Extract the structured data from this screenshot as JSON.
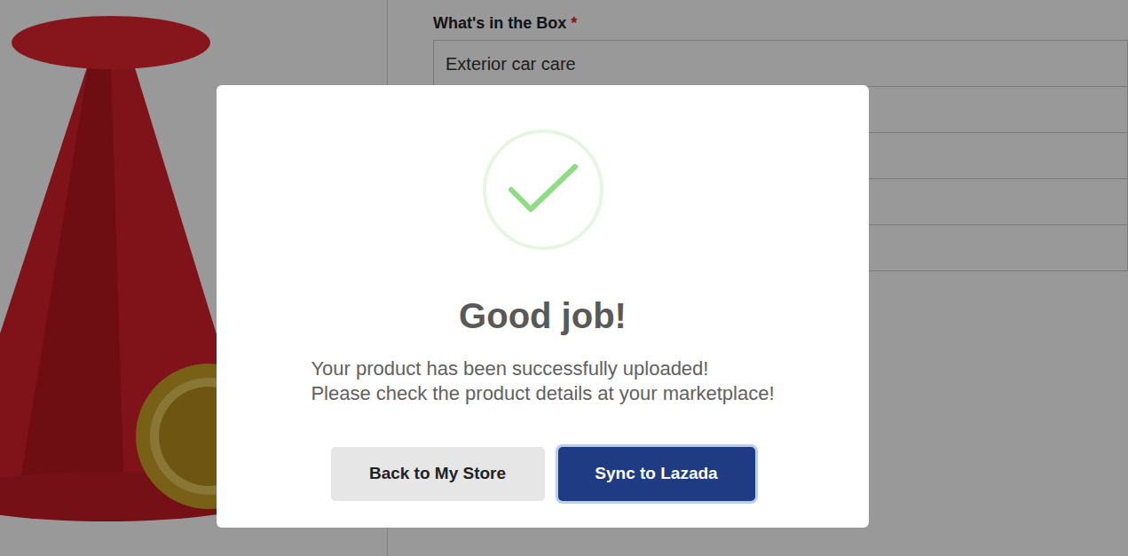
{
  "page": {
    "form": {
      "label": "What's in the Box",
      "required_mark": "*",
      "fields": [
        {
          "value": "Exterior car care"
        },
        {
          "value": ""
        },
        {
          "value": ""
        },
        {
          "value": ""
        },
        {
          "value": ""
        }
      ]
    }
  },
  "dialog": {
    "title": "Good job!",
    "message_lines": [
      "Your product has been successfully uploaded!",
      "Please check the product details at your marketplace!"
    ],
    "buttons": [
      {
        "label": "Back to My Store",
        "kind": "secondary"
      },
      {
        "label": "Sync to Lazada",
        "kind": "primary"
      }
    ]
  }
}
